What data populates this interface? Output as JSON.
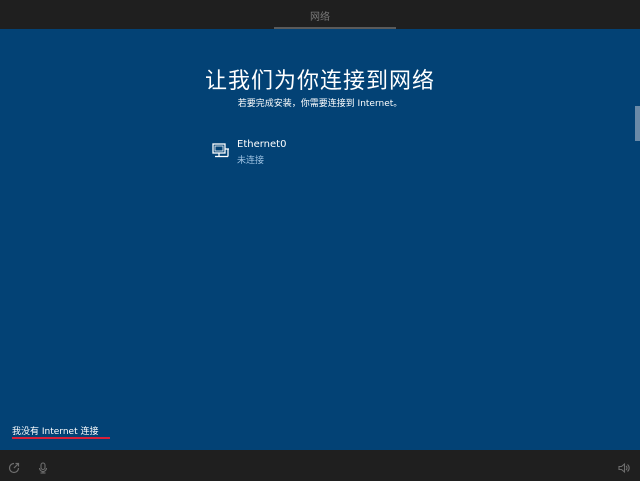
{
  "topbar": {
    "title": "网络"
  },
  "main": {
    "heading": "让我们为你连接到网络",
    "subheading": "若要完成安装，你需要连接到 Internet。"
  },
  "networks": [
    {
      "name": "Ethernet0",
      "status": "未连接",
      "icon": "ethernet-icon"
    }
  ],
  "footer": {
    "no_internet_label": "我没有 Internet 连接"
  },
  "bottombar": {
    "icons": [
      "ease-of-access-icon",
      "microphone-icon",
      "volume-icon"
    ]
  },
  "colors": {
    "background": "#034275",
    "bars": "#1f1f1f",
    "link_underline": "#d8203a"
  }
}
